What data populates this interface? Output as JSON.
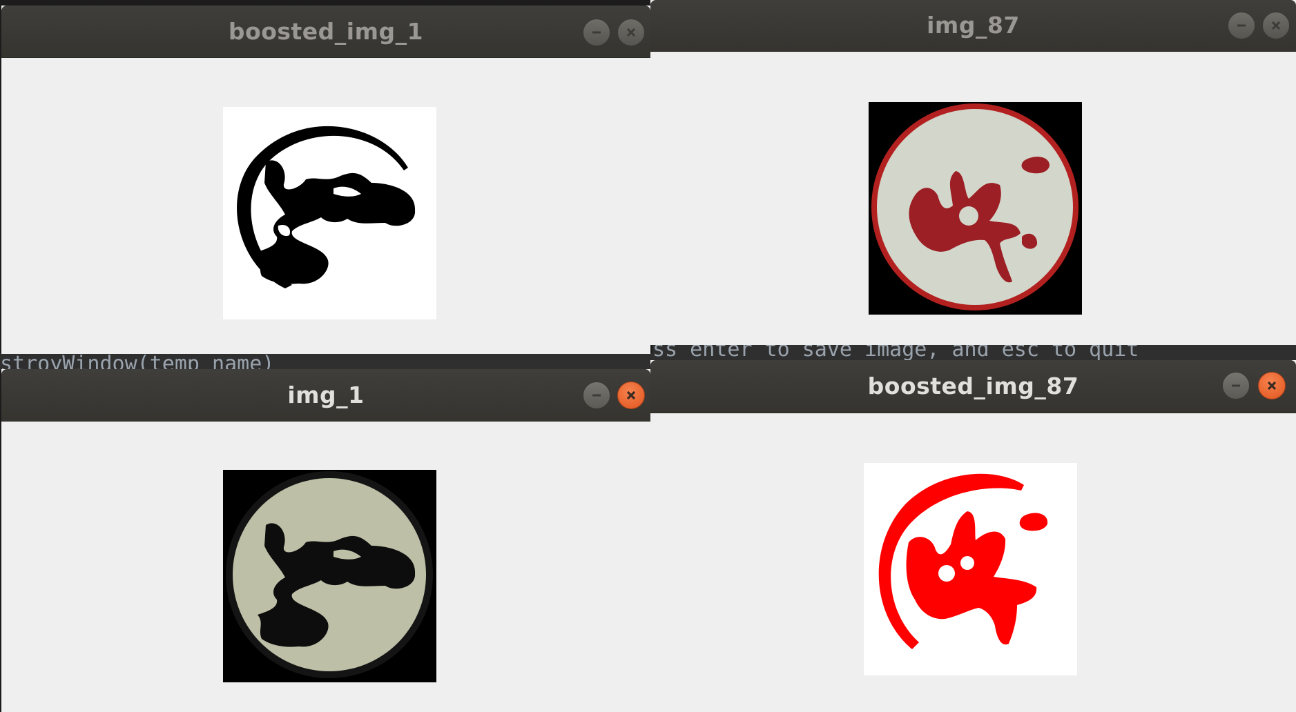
{
  "terminal": {
    "left_line": "stroyWindow(temp_name)",
    "right_line": "ss enter to save image, and esc to quit"
  },
  "windows": [
    {
      "id": "boosted_img_1",
      "title": "boosted_img_1",
      "state": "inactive",
      "content": "thresholded black seal on white"
    },
    {
      "id": "img_87",
      "title": "img_87",
      "state": "inactive",
      "content": "photo of red seal on cream circle"
    },
    {
      "id": "img_1",
      "title": "img_1",
      "state": "active",
      "content": "photo of black seal on grey-green circle"
    },
    {
      "id": "boosted_img_87",
      "title": "boosted_img_87",
      "state": "active",
      "content": "thresholded red seal on white"
    }
  ],
  "controls": {
    "minimize_icon": "minimize-icon",
    "close_icon": "close-icon"
  },
  "colors": {
    "titlebar": "#3c3b37",
    "window_bg": "#efefef",
    "close_active": "#e95420",
    "seal_black": "#000000",
    "seal_red": "#ff0000",
    "seal_dark_red": "#9b1f24"
  }
}
